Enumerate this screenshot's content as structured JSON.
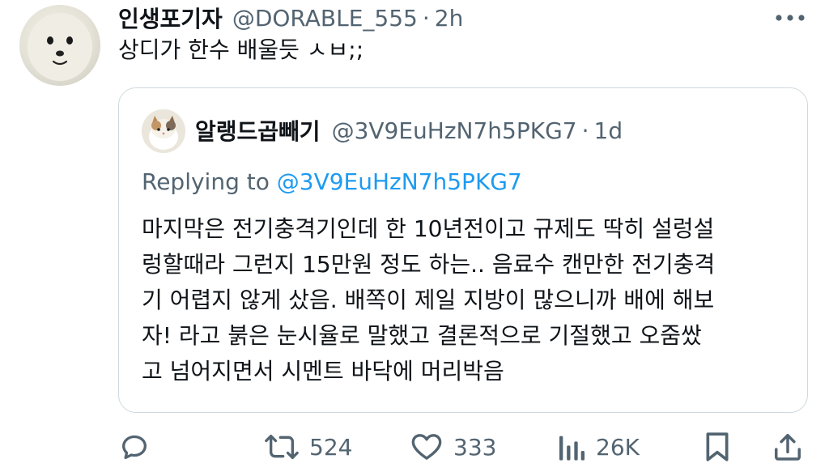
{
  "tweet": {
    "author_name": "인생포기자",
    "author_handle": "@DORABLE_555",
    "separator": "·",
    "time": "2h",
    "text": "상디가 한수 배울듯 ㅅㅂ;;"
  },
  "quote": {
    "author_name": "알랭드곱빼기",
    "author_handle": "@3V9EuHzN7h5PKG7",
    "separator": "·",
    "time": "1d",
    "replying_prefix": "Replying to",
    "replying_handle": "@3V9EuHzN7h5PKG7",
    "lines": [
      "마지막은 전기충격기인데 한 10년전이고 규제도 딱히 설렁설",
      "렁할때라 그런지 15만원 정도 하는.. 음료수 캔만한 전기충격",
      "기 어렵지 않게 샀음. 배쪽이 제일 지방이 많으니까 배에 해보",
      "자! 라고 붉은 눈시율로 말했고 결론적으로 기절했고 오줌쌌",
      "고 넘어지면서 시멘트 바닥에 머리박음"
    ]
  },
  "actions": {
    "reply_icon": "reply-icon",
    "retweet_count": "524",
    "like_count": "333",
    "views_count": "26K",
    "bookmark_icon": "bookmark-icon",
    "share_icon": "share-icon"
  },
  "colors": {
    "text_primary": "#0f1419",
    "text_secondary": "#536471",
    "link": "#1d9bf0",
    "border": "#cfd9de"
  }
}
